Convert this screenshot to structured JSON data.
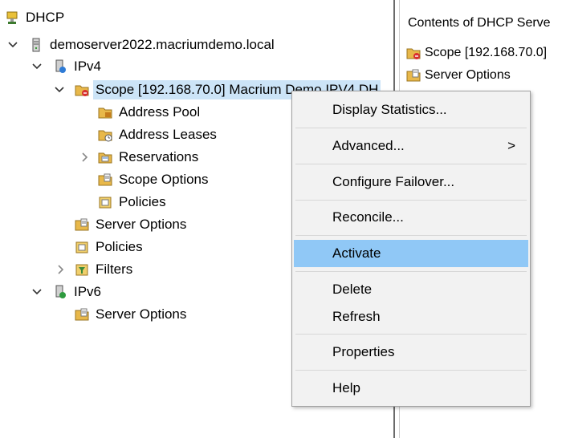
{
  "tree": {
    "root_label": "DHCP",
    "server_label": "demoserver2022.macriumdemo.local",
    "ipv4_label": "IPv4",
    "scope_label": "Scope [192.168.70.0] Macrium Demo IPV4 DH",
    "address_pool_label": "Address Pool",
    "address_leases_label": "Address Leases",
    "reservations_label": "Reservations",
    "scope_options_label": "Scope Options",
    "scope_policies_label": "Policies",
    "ipv4_server_options_label": "Server Options",
    "ipv4_policies_label": "Policies",
    "filters_label": "Filters",
    "ipv6_label": "IPv6",
    "ipv6_server_options_label": "Server Options"
  },
  "right_pane": {
    "header": "Contents of DHCP Serve",
    "items": [
      "Scope [192.168.70.0]",
      "Server Options"
    ]
  },
  "context_menu": {
    "display_statistics": "Display Statistics...",
    "advanced": "Advanced...",
    "advanced_arrow": ">",
    "configure_failover": "Configure Failover...",
    "reconcile": "Reconcile...",
    "activate": "Activate",
    "delete": "Delete",
    "refresh": "Refresh",
    "properties": "Properties",
    "help": "Help"
  },
  "colors": {
    "selection": "#cce4f7",
    "menu_highlight": "#90c8f6",
    "menu_background": "#f2f2f2"
  }
}
